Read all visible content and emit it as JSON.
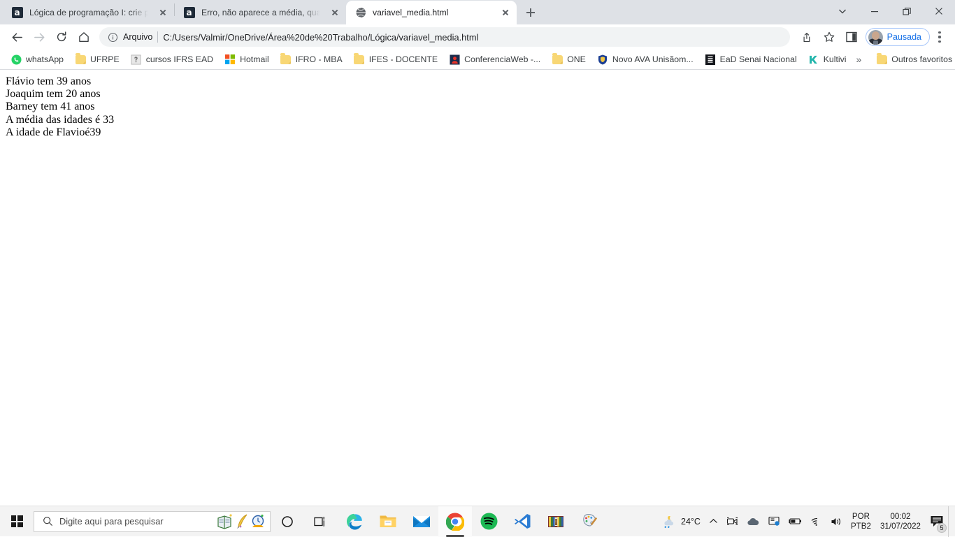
{
  "window": {
    "controls": [
      {
        "name": "tab-search",
        "icon": "chevron-down-icon"
      },
      {
        "name": "minimize",
        "icon": "minimize-icon"
      },
      {
        "name": "restore",
        "icon": "restore-icon"
      },
      {
        "name": "close",
        "icon": "close-icon"
      }
    ]
  },
  "tabs": [
    {
      "title": "Lógica de programação I: crie pro",
      "favicon": "alura-icon",
      "active": false
    },
    {
      "title": "Erro, não aparece a média, quanc",
      "favicon": "alura-icon",
      "active": false
    },
    {
      "title": "variavel_media.html",
      "favicon": "globe-icon",
      "active": true
    }
  ],
  "newtab_label": "+",
  "toolbar": {
    "back": "back-arrow-icon",
    "forward": "forward-arrow-icon",
    "reload": "reload-icon",
    "home": "home-icon",
    "scheme_label": "Arquivo",
    "url": "C:/Users/Valmir/OneDrive/Área%20de%20Trabalho/Lógica/variavel_media.html",
    "share": "share-icon",
    "bookmark_star": "star-icon",
    "side_panel": "side-panel-icon",
    "profile_name": "Pausada",
    "menu": "three-dot-menu-icon"
  },
  "bookmarks": {
    "items": [
      {
        "label": "whatsApp",
        "icon": "whatsapp-icon"
      },
      {
        "label": "UFRPE",
        "icon": "folder-icon"
      },
      {
        "label": "cursos IFRS EAD",
        "icon": "generic-site-icon"
      },
      {
        "label": "Hotmail",
        "icon": "microsoft-icon"
      },
      {
        "label": "IFRO - MBA",
        "icon": "folder-icon"
      },
      {
        "label": "IFES - DOCENTE",
        "icon": "folder-icon"
      },
      {
        "label": "ConferenciaWeb -...",
        "icon": "conferenciaweb-icon"
      },
      {
        "label": "ONE",
        "icon": "folder-icon"
      },
      {
        "label": "Novo AVA Unisãom...",
        "icon": "shield-icon"
      },
      {
        "label": "EaD Senai Nacional",
        "icon": "senai-icon"
      },
      {
        "label": "Kultivi",
        "icon": "kultivi-icon"
      }
    ],
    "overflow_label": "»",
    "other_bookmarks_label": "Outros favoritos"
  },
  "page": {
    "lines": [
      "Flávio tem 39 anos",
      "Joaquim tem 20 anos",
      "Barney tem 41 anos",
      "A média das idades é 33",
      "A idade de Flavioé39"
    ]
  },
  "taskbar": {
    "start_icon": "windows-logo-icon",
    "search_placeholder": "Digite aqui para pesquisar",
    "search_icon": "search-icon",
    "cortana_icon": "cortana-circle-icon",
    "taskview_icon": "task-view-icon",
    "apps": [
      {
        "name": "microsoft-edge",
        "icon": "edge-icon",
        "running": false,
        "active": false
      },
      {
        "name": "file-explorer",
        "icon": "folder-explorer-icon",
        "running": false,
        "active": false
      },
      {
        "name": "mail",
        "icon": "mail-icon",
        "running": false,
        "active": false
      },
      {
        "name": "google-chrome",
        "icon": "chrome-icon",
        "running": true,
        "active": true
      },
      {
        "name": "spotify",
        "icon": "spotify-icon",
        "running": true,
        "active": false
      },
      {
        "name": "visual-studio-code",
        "icon": "vscode-icon",
        "running": true,
        "active": false
      },
      {
        "name": "winrar",
        "icon": "winrar-icon",
        "running": true,
        "active": false
      },
      {
        "name": "paint",
        "icon": "paint-icon",
        "running": true,
        "active": false
      }
    ],
    "tray": {
      "weather_icon": "rain-night-icon",
      "temperature": "24°C",
      "overflow_icon": "chevron-up-icon",
      "camera_icon": "camera-icon",
      "onedrive_icon": "cloud-icon",
      "display_icon": "display-icon",
      "battery_icon": "battery-icon",
      "wifi_icon": "wifi-icon",
      "volume_icon": "speaker-icon",
      "lang_line1": "POR",
      "lang_line2": "PTB2",
      "time": "00:02",
      "date": "31/07/2022",
      "notifications_icon": "notification-icon",
      "notifications_count": "5"
    }
  },
  "colors": {
    "chrome_frame": "#dee1e6",
    "accent_blue": "#1a73e8",
    "taskbar": "#f3f3f3",
    "folder_yellow": "#f8d775"
  }
}
